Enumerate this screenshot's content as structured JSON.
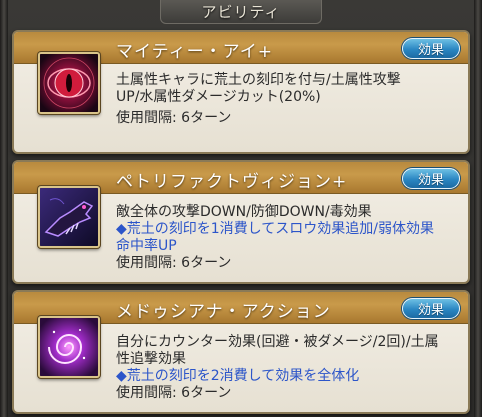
{
  "header": {
    "title": "アビリティ"
  },
  "abilities": [
    {
      "name": "マイティー・アイ+",
      "effect_label": "効果",
      "icon": "red-eye-icon",
      "description": "土属性キャラに荒土の刻印を付与/土属性攻撃UP/水属性ダメージカット(20%)",
      "extra": "",
      "cooldown": "使用間隔: 6ターン"
    },
    {
      "name": "ペトリファクトヴィジョン+",
      "effect_label": "効果",
      "icon": "purple-dragon-icon",
      "description": "敵全体の攻撃DOWN/防御DOWN/毒効果",
      "extra": "◆荒土の刻印を1消費してスロウ効果追加/弱体効果命中率UP",
      "cooldown": "使用間隔: 6ターン"
    },
    {
      "name": "メドゥシアナ・アクション",
      "effect_label": "効果",
      "icon": "purple-swirl-icon",
      "description": "自分にカウンター効果(回避・被ダメージ/2回)/土属性追撃効果",
      "extra": "◆荒土の刻印を2消費して効果を全体化",
      "cooldown": "使用間隔: 6ターン"
    }
  ]
}
